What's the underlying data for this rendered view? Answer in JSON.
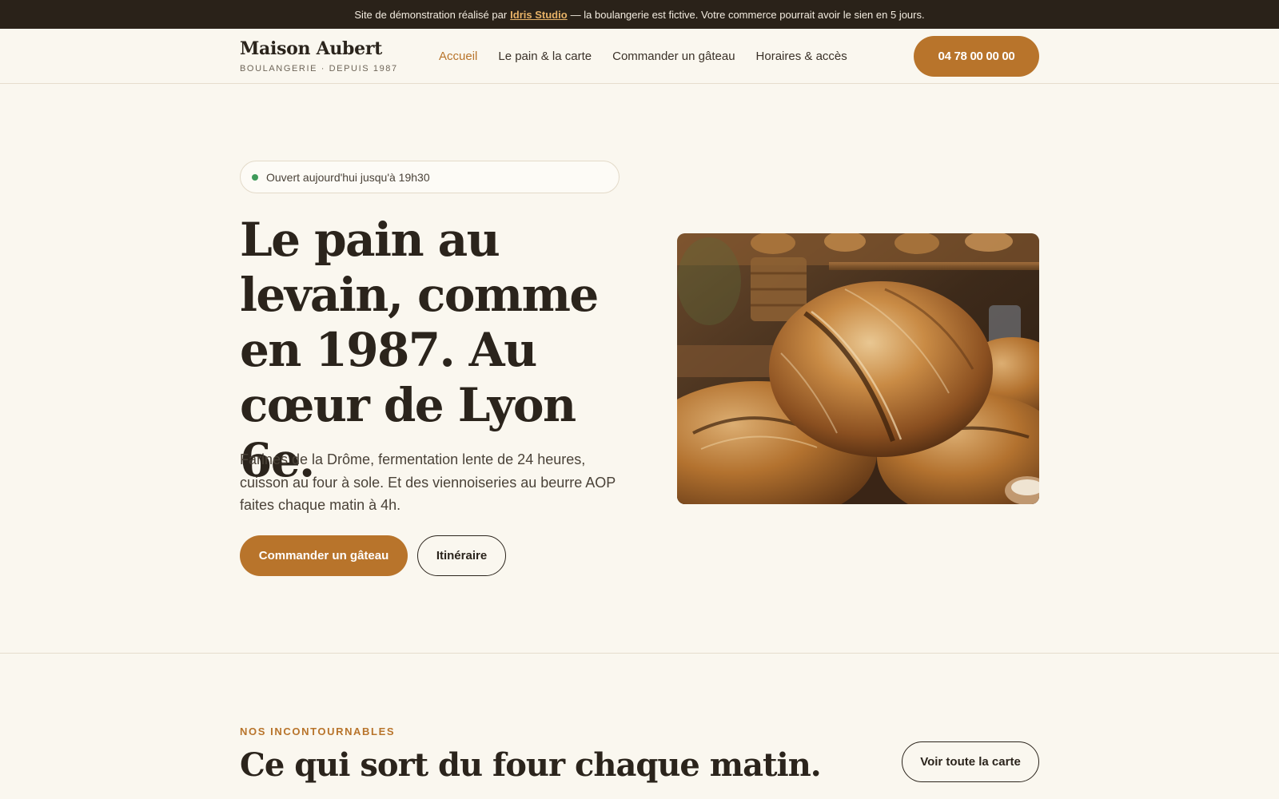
{
  "topbar": {
    "before": "Site de démonstration réalisé par",
    "link": "Idris Studio",
    "after": "— la boulangerie est fictive. Votre commerce pourrait avoir le sien en 5 jours."
  },
  "header": {
    "brand_name": "Maison Aubert",
    "brand_tagline": "BOULANGERIE · DEPUIS 1987",
    "nav": [
      {
        "label": "Accueil",
        "active": true
      },
      {
        "label": "Le pain & la carte",
        "active": false
      },
      {
        "label": "Commander un gâteau",
        "active": false
      },
      {
        "label": "Horaires & accès",
        "active": false
      }
    ],
    "phone": "04 78 00 00 00"
  },
  "hero": {
    "status": "Ouvert aujourd'hui jusqu'à 19h30",
    "title_lines": [
      "Le pain au",
      "levain, comme",
      "en 1987. Au",
      "cœur de Lyon 6e."
    ],
    "text": "Farines de la Drôme, fermentation lente de 24 heures, cuisson au four à sole. Et des viennoiseries au beurre AOP faites chaque matin à 4h.",
    "cta_primary": "Commander un gâteau",
    "cta_secondary": "Itinéraire",
    "image": "bread-loaves-photo"
  },
  "section": {
    "eyebrow": "NOS INCONTOURNABLES",
    "title": "Ce qui sort du four chaque matin.",
    "button": "Voir toute la carte"
  },
  "colors": {
    "accent": "#b8742b",
    "topbar_bg": "#2a2219",
    "page_bg": "#faf7ef",
    "status_dot": "#3f9a5a"
  }
}
